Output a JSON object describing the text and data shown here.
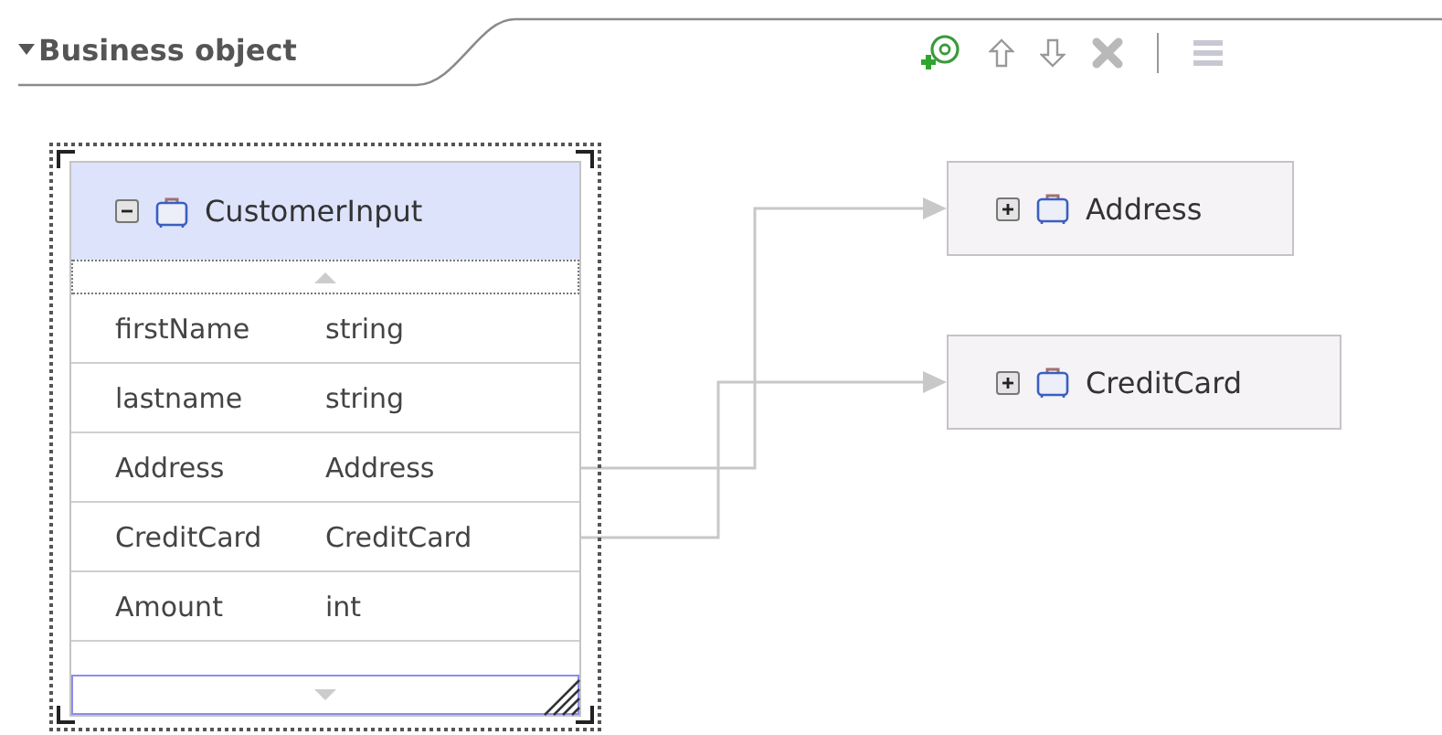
{
  "section": {
    "title": "Business object",
    "expanded": true
  },
  "toolbar": [
    {
      "kind": "add-attribute"
    },
    {
      "kind": "move-up"
    },
    {
      "kind": "move-down"
    },
    {
      "kind": "delete"
    },
    {
      "kind": "separator"
    },
    {
      "kind": "show-list"
    }
  ],
  "main_node": {
    "name": "CustomerInput",
    "expanded": true,
    "selected": true,
    "fields": [
      {
        "name": "firstName",
        "type": "string",
        "linked": false
      },
      {
        "name": "lastname",
        "type": "string",
        "linked": false
      },
      {
        "name": "Address",
        "type": "Address",
        "linked": true
      },
      {
        "name": "CreditCard",
        "type": "CreditCard",
        "linked": true
      },
      {
        "name": "Amount",
        "type": "int",
        "linked": false
      }
    ]
  },
  "nodes": [
    {
      "name": "Address",
      "expanded": false
    },
    {
      "name": "CreditCard",
      "expanded": false
    }
  ]
}
